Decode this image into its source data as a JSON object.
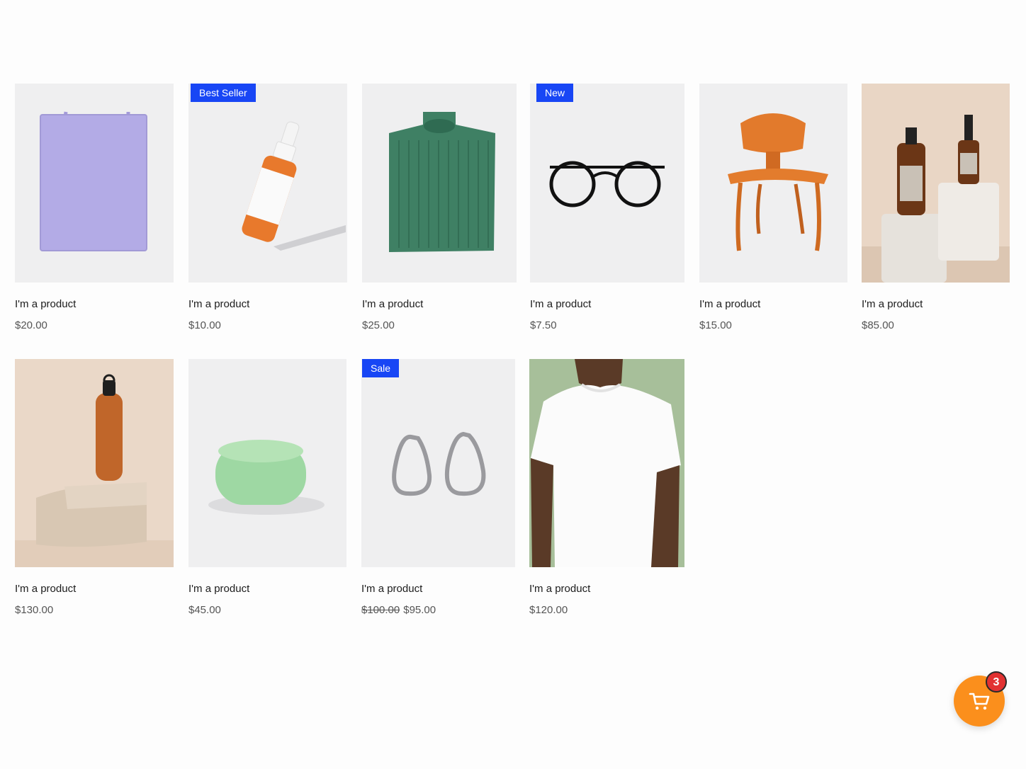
{
  "colors": {
    "badge_blue": "#1846f5",
    "cart_orange": "#fb8f1c",
    "cart_badge_red": "#e23232"
  },
  "products": [
    {
      "name": "I'm a product",
      "price": "$20.00",
      "image": "lavender-tote-bag"
    },
    {
      "name": "I'm a product",
      "price": "$10.00",
      "badge": "Best Seller",
      "image": "orange-dropper-bottle"
    },
    {
      "name": "I'm a product",
      "price": "$25.00",
      "image": "green-knit-sweater"
    },
    {
      "name": "I'm a product",
      "price": "$7.50",
      "badge": "New",
      "image": "black-eyeglasses"
    },
    {
      "name": "I'm a product",
      "price": "$15.00",
      "image": "orange-wooden-chair"
    },
    {
      "name": "I'm a product",
      "price": "$85.00",
      "image": "amber-pump-bottles"
    },
    {
      "name": "I'm a product",
      "price": "$130.00",
      "image": "copper-water-bottle"
    },
    {
      "name": "I'm a product",
      "price": "$45.00",
      "image": "green-soap-bar"
    },
    {
      "name": "I'm a product",
      "old_price": "$100.00",
      "price": "$95.00",
      "badge": "Sale",
      "image": "silver-hoop-earrings"
    },
    {
      "name": "I'm a product",
      "price": "$120.00",
      "image": "white-tshirt-model"
    }
  ],
  "cart": {
    "count": "3",
    "icon": "cart-icon"
  }
}
